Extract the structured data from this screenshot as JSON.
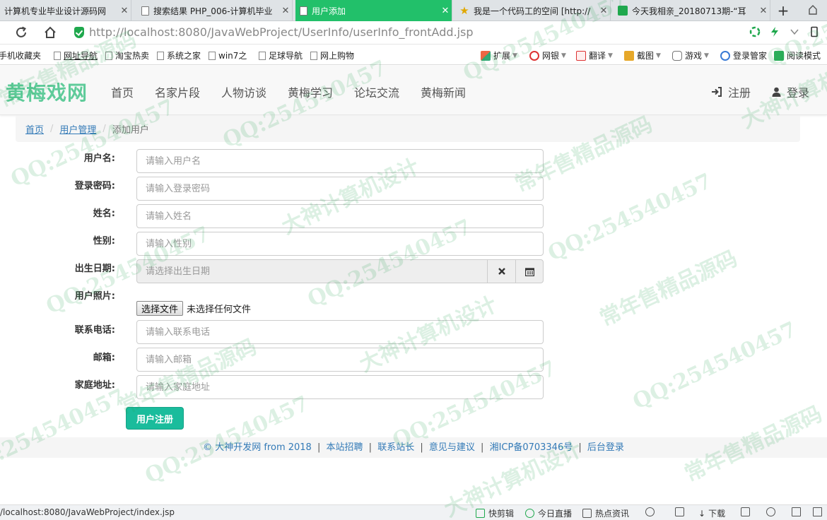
{
  "browser": {
    "tabs": [
      {
        "title": "计算机专业毕业设计源码网",
        "active": false,
        "icon": "doc-icon"
      },
      {
        "title": "搜索结果 PHP_006-计算机毕业",
        "active": false,
        "icon": "doc-icon"
      },
      {
        "title": "用户添加",
        "active": true,
        "icon": "doc-icon"
      },
      {
        "title": "我是一个代码工的空间 [http://",
        "active": false,
        "icon": "star-icon"
      },
      {
        "title": "今天我相亲_20180713期-“耳",
        "active": false,
        "icon": "video-icon"
      }
    ],
    "new_tab": "+",
    "close_glyph": "✕",
    "url_host": "http://localhost",
    "url_rest": ":8080/JavaWebProject/UserInfo/userInfo_frontAdd.jsp",
    "bookmarks": [
      "手机收藏夹",
      "网址导航",
      "淘宝热卖",
      "系统之家",
      "win7之",
      "足球导航",
      "网上购物"
    ],
    "tools": [
      "扩展",
      "网银",
      "翻译",
      "截图",
      "游戏",
      "登录管家",
      "阅读模式"
    ],
    "status_url": "/localhost:8080/JavaWebProject/index.jsp",
    "status_items": [
      "快剪辑",
      "今日直播",
      "热点资讯",
      "",
      "",
      "下载",
      "",
      "",
      ""
    ]
  },
  "site": {
    "brand": "黄梅戏网",
    "nav": [
      "首页",
      "名家片段",
      "人物访谈",
      "黄梅学习",
      "论坛交流",
      "黄梅新闻"
    ],
    "register": "注册",
    "login": "登录"
  },
  "breadcrumb": {
    "home": "首页",
    "section": "用户管理",
    "current": "添加用户",
    "separator": "/"
  },
  "form": {
    "username": {
      "label": "用户名:",
      "placeholder": "请输入用户名",
      "value": ""
    },
    "password": {
      "label": "登录密码:",
      "placeholder": "请输入登录密码",
      "value": ""
    },
    "name": {
      "label": "姓名:",
      "placeholder": "请输入姓名",
      "value": ""
    },
    "gender": {
      "label": "性别:",
      "placeholder": "请输入性别",
      "value": ""
    },
    "birthday": {
      "label": "出生日期:",
      "placeholder": "请选择出生日期",
      "value": ""
    },
    "photo": {
      "label": "用户照片:",
      "button": "选择文件",
      "status": "未选择任何文件"
    },
    "phone": {
      "label": "联系电话:",
      "placeholder": "请输入联系电话",
      "value": ""
    },
    "email": {
      "label": "邮箱:",
      "placeholder": "请输入邮箱",
      "value": ""
    },
    "address": {
      "label": "家庭地址:",
      "placeholder": "请输入家庭地址",
      "value": ""
    },
    "submit": "用户注册"
  },
  "footer": {
    "copyright": "© 大神开发网 from 2018",
    "links": [
      "本站招聘",
      "联系站长",
      "意见与建议",
      "湘ICP备0703346号",
      "后台登录"
    ],
    "separator": "|"
  },
  "watermark": {
    "lines": [
      "常年售精品源码",
      "大神计算机设计",
      "QQ:254540457"
    ]
  },
  "colors": {
    "brand": "#5fcb9a",
    "active_tab": "#22c06a",
    "submit": "#1abc9c",
    "link": "#337ab7"
  }
}
